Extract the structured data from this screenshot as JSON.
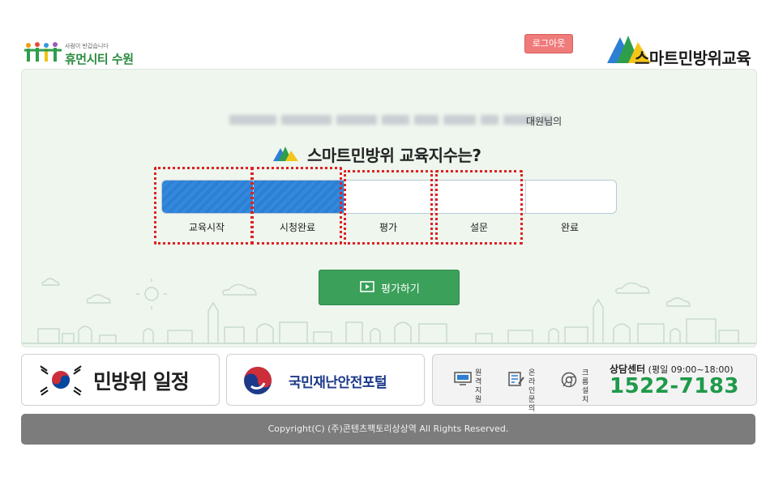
{
  "header": {
    "city_tagline": "사람이 반갑습니다",
    "city_name": "휴먼시티 수원",
    "logout_label": "로그아웃",
    "brand_name": "스마트민방위교육"
  },
  "main": {
    "name_suffix": "대원님의",
    "title": "스마트민방위 교육지수는?",
    "progress_fraction": 0.4,
    "steps": [
      "교육시작",
      "시청완료",
      "평가",
      "설문",
      "완료"
    ],
    "eval_button": "평가하기"
  },
  "banners": {
    "schedule": "민방위 일정",
    "portal": "국민재난안전포털",
    "services": [
      {
        "label1": "원격",
        "label2": "지원",
        "icon": "monitor-icon"
      },
      {
        "label1": "온라인",
        "label2": "문의",
        "icon": "edit-icon"
      },
      {
        "label1": "크롬",
        "label2": "설치",
        "icon": "chrome-icon"
      }
    ],
    "consult_title": "상담센터",
    "consult_hours": "(평일 09:00~18:00)",
    "consult_phone": "1522-7183"
  },
  "footer": {
    "copyright": "Copyright(C) (주)콘텐츠팩토리상상역   All Rights Reserved."
  },
  "colors": {
    "accent_green": "#3aa05a",
    "progress_blue": "#2d7fd3",
    "logout_red": "#f07b7b",
    "phone_green": "#1f9a4a"
  }
}
